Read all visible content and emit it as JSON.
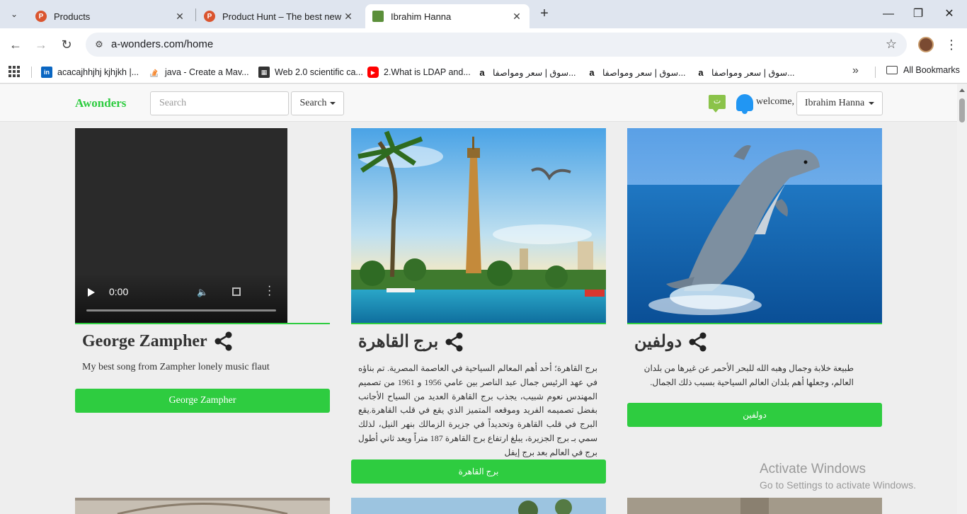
{
  "browser": {
    "tabs": [
      {
        "title": "Products",
        "favicon_letter": "P",
        "favicon_color": "#da552f"
      },
      {
        "title": "Product Hunt – The best new p",
        "favicon_letter": "P",
        "favicon_color": "#da552f"
      },
      {
        "title": "Ibrahim Hanna",
        "favicon_color": "#5b8f3a"
      }
    ],
    "new_tab_symbol": "+",
    "window_controls": {
      "minimize": "—",
      "maximize": "❐",
      "close": "✕"
    },
    "url": "a-wonders.com/home",
    "bookmarks": [
      {
        "label": "acacajhhjhj kjhjkh |...",
        "icon": "linkedin-icon",
        "color": "#0a66c2",
        "glyph": "in"
      },
      {
        "label": "java - Create a Mav...",
        "icon": "stackoverflow-icon",
        "color": "#f48024",
        "glyph": ""
      },
      {
        "label": "Web 2.0 scientific ca...",
        "icon": "calculator-icon",
        "color": "#333333",
        "glyph": ""
      },
      {
        "label": "2.What is LDAP and...",
        "icon": "youtube-icon",
        "color": "#ff0000",
        "glyph": "▶"
      },
      {
        "label": "سوق | سعر ومواصفا...",
        "icon": "amazon-icon",
        "color": "#ffffff",
        "glyph": "a"
      },
      {
        "label": "سوق | سعر ومواصفا...",
        "icon": "amazon-icon",
        "color": "#ffffff",
        "glyph": "a"
      },
      {
        "label": "سوق | سعر ومواصفا...",
        "icon": "amazon-icon",
        "color": "#ffffff",
        "glyph": "a"
      }
    ],
    "more_bookmarks": "»",
    "all_bookmarks": "All Bookmarks"
  },
  "nav": {
    "brand": "Awonders",
    "search_placeholder": "Search",
    "search_button": "Search",
    "message_icon_glyph": "ت",
    "welcome": "welcome,",
    "user_name": "Ibrahim Hanna"
  },
  "cards": [
    {
      "type": "video",
      "title": "George Zampher",
      "description": "My best song from Zampher lonely music flaut",
      "button": "George Zampher",
      "video_time": "0:00",
      "video_progress": 0
    },
    {
      "type": "image",
      "image": "cairo-tower-photo",
      "title": "برج القاهرة",
      "description": "برج القاهرة؛ أحد أهم المعالم السياحية في العاصمة المصرية. تم بناؤه في عهد الرئيس جمال عبد الناصر بين عامي 1956 و 1961 من تصميم المهندس نعوم شبيب، يجذب برج القاهرة العديد من السياح الأجانب بفضل تصميمه الفريد وموقعه المتميز الذي يقع في قلب القاهرة.يقع البرج في قلب القاهرة وتحديداً في جزيرة الزمالك بنهر النيل، لذلك سمي بـ برج الجزيرة، يبلغ ارتفاع برج القاهرة 187 متراً ويعد ثاني أطول برج في العالم بعد برج إيفل",
      "button": "برج القاهرة"
    },
    {
      "type": "image",
      "image": "dolphin-photo",
      "title": "دولفين",
      "description": "طبيعة خلابة وجمال وهبه الله للبحر الأحمر عن غيرها من بلدان العالم، وجعلها أهم بلدان العالم السياحية بسبب ذلك الجمال.",
      "button": "دولفين"
    }
  ],
  "os_overlay": {
    "line1": "Activate Windows",
    "line2": "Go to Settings to activate Windows."
  },
  "colors": {
    "accent": "#2ecc40",
    "page_bg": "#eeeeee"
  }
}
